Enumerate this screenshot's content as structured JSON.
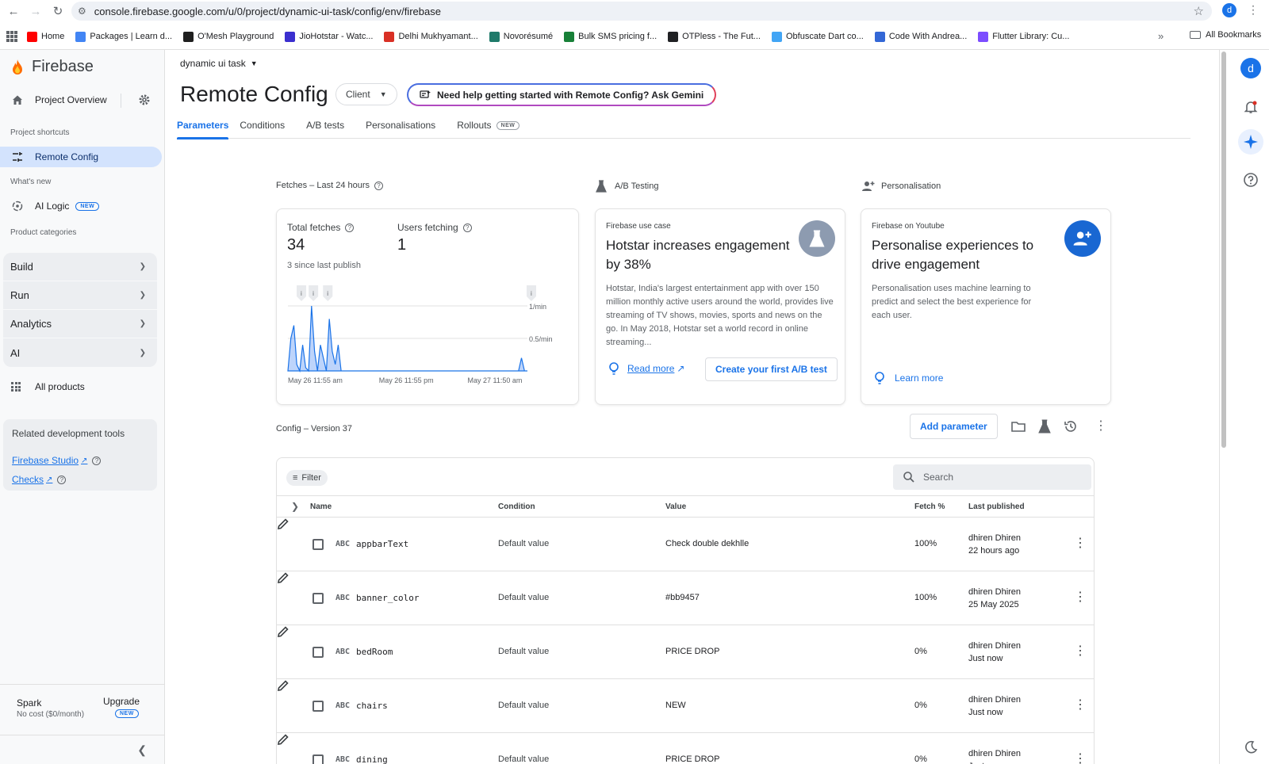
{
  "browser": {
    "url": "console.firebase.google.com/u/0/project/dynamic-ui-task/config/env/firebase",
    "profile_initial": "d",
    "bookmarks": [
      {
        "label": "Home",
        "color": "#ff0000"
      },
      {
        "label": "Packages | Learn d...",
        "color": "#4285f4"
      },
      {
        "label": "O'Mesh Playground",
        "color": "#1f1f1f"
      },
      {
        "label": "JioHotstar - Watc...",
        "color": "#3b2fcf"
      },
      {
        "label": "Delhi Mukhyamant...",
        "color": "#d93025"
      },
      {
        "label": "Novorésumé",
        "color": "#1f7a6a"
      },
      {
        "label": "Bulk SMS pricing f...",
        "color": "#188038"
      },
      {
        "label": "OTPless - The Fut...",
        "color": "#202124"
      },
      {
        "label": "Obfuscate Dart co...",
        "color": "#42a5f5"
      },
      {
        "label": "Code With Andrea...",
        "color": "#3367d6"
      },
      {
        "label": "Flutter Library: Cu...",
        "color": "#7c4dff"
      }
    ],
    "all_bookmarks": "All Bookmarks"
  },
  "sidebar": {
    "brand": "Firebase",
    "project_overview": "Project Overview",
    "project_shortcuts": "Project shortcuts",
    "remote_config": "Remote Config",
    "whats_new": "What's new",
    "ai_logic": "AI Logic",
    "new_badge": "NEW",
    "product_categories": "Product categories",
    "categories": [
      "Build",
      "Run",
      "Analytics",
      "AI"
    ],
    "all_products": "All products",
    "related_title": "Related development tools",
    "firebase_studio": "Firebase Studio",
    "checks": "Checks",
    "plan_name": "Spark",
    "plan_cost": "No cost ($0/month)",
    "upgrade": "Upgrade"
  },
  "header": {
    "project": "dynamic ui task",
    "title": "Remote Config",
    "client_select": "Client",
    "gemini_prompt": "Need help getting started with Remote Config? Ask Gemini",
    "tabs": [
      "Parameters",
      "Conditions",
      "A/B tests",
      "Personalisations",
      "Rollouts"
    ],
    "rollouts_badge": "NEW"
  },
  "fetches": {
    "section_label": "Fetches – Last 24 hours",
    "total_label": "Total fetches",
    "total_value": "34",
    "since_publish": "3 since last publish",
    "users_label": "Users fetching",
    "users_value": "1",
    "marker_label": "i",
    "y_labels": [
      "1/min",
      "0.5/min"
    ],
    "x_labels": [
      "May 26 11:55 am",
      "May 26 11:55 pm",
      "May 27 11:50 am"
    ]
  },
  "chart_data": {
    "type": "area",
    "title": "",
    "xlabel": "",
    "ylabel": "",
    "x_ticks": [
      "May 26 11:55 am",
      "May 26 11:55 pm",
      "May 27 11:50 am"
    ],
    "ylim": [
      0,
      1
    ],
    "y_ticks": [
      "0.5/min",
      "1/min"
    ],
    "series": [
      {
        "values": [
          0,
          0.5,
          0.7,
          0.1,
          0,
          0.4,
          0.05,
          0,
          1.0,
          0.3,
          0,
          0.4,
          0.2,
          0,
          0.8,
          0.3,
          0.1,
          0.4,
          0,
          0,
          0,
          0,
          0,
          0,
          0,
          0,
          0,
          0,
          0,
          0,
          0,
          0,
          0,
          0,
          0,
          0,
          0,
          0,
          0,
          0,
          0,
          0,
          0,
          0,
          0,
          0,
          0,
          0,
          0,
          0,
          0,
          0,
          0,
          0,
          0,
          0,
          0,
          0,
          0,
          0,
          0,
          0,
          0,
          0,
          0,
          0,
          0,
          0,
          0,
          0,
          0,
          0,
          0,
          0,
          0,
          0,
          0,
          0,
          0,
          0.2,
          0,
          0
        ]
      }
    ],
    "markers_at": [
      0.03,
      0.08,
      0.14,
      0.99
    ]
  },
  "ab_testing": {
    "section_label": "A/B Testing",
    "kicker": "Firebase use case",
    "title": "Hotstar increases engagement by 38%",
    "body": "Hotstar, India's largest entertainment app with over 150 million monthly active users around the world, provides live streaming of TV shows, movies, sports and news on the go. In May 2018, Hotstar set a world record in online streaming...",
    "read_more": "Read more",
    "cta": "Create your first A/B test"
  },
  "personalisation": {
    "section_label": "Personalisation",
    "kicker": "Firebase on Youtube",
    "title": "Personalise experiences to drive engagement",
    "body": "Personalisation uses machine learning to predict and select the best experience for each user.",
    "learn_more": "Learn more"
  },
  "config": {
    "version_label": "Config – Version 37",
    "add_parameter": "Add parameter",
    "filter": "Filter",
    "search_placeholder": "Search",
    "columns": [
      "Name",
      "Condition",
      "Value",
      "Fetch %",
      "Last published"
    ],
    "type_label": "ABC",
    "rows": [
      {
        "name": "appbarText",
        "condition": "Default value",
        "value": "Check double dekhlle",
        "fetch": "100%",
        "user": "dhiren Dhiren",
        "when": "22 hours ago"
      },
      {
        "name": "banner_color",
        "condition": "Default value",
        "value": "#bb9457",
        "fetch": "100%",
        "user": "dhiren Dhiren",
        "when": "25 May 2025"
      },
      {
        "name": "bedRoom",
        "condition": "Default value",
        "value": "PRICE DROP",
        "fetch": "0%",
        "user": "dhiren Dhiren",
        "when": "Just now"
      },
      {
        "name": "chairs",
        "condition": "Default value",
        "value": "NEW",
        "fetch": "0%",
        "user": "dhiren Dhiren",
        "when": "Just now"
      },
      {
        "name": "dining",
        "condition": "Default value",
        "value": "PRICE DROP",
        "fetch": "0%",
        "user": "dhiren Dhiren",
        "when": "Just now"
      }
    ]
  }
}
